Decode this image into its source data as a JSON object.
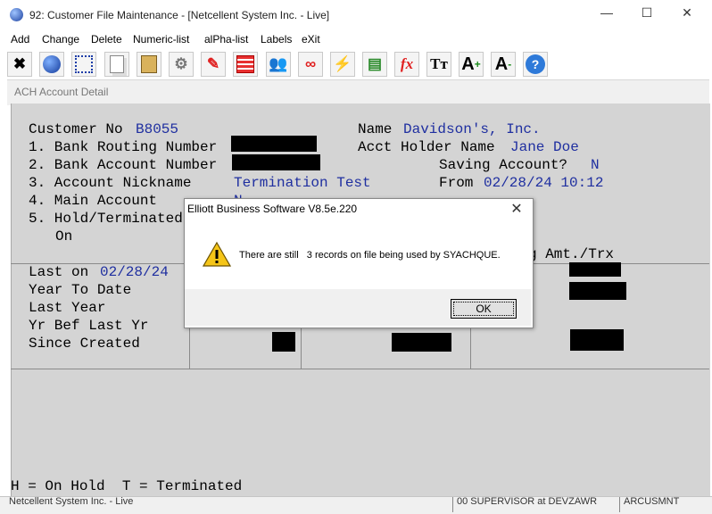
{
  "window": {
    "title": "92: Customer File Maintenance - [Netcellent System Inc. - Live]",
    "minimize": "—",
    "maximize": "☐",
    "close": "✕"
  },
  "menu": {
    "items": [
      "Add",
      "Change",
      "Delete",
      "Numeric-list",
      "alPha-list",
      "Labels",
      "eXit"
    ]
  },
  "toolbar": {
    "icons": [
      "exit-icon",
      "globe-icon",
      "select-icon",
      "copy-icon",
      "paste-icon",
      "settings-icon",
      "edit-icon",
      "table-icon",
      "users-icon",
      "link-icon",
      "lightning-icon",
      "chart-icon",
      "function-icon",
      "font-size-icon",
      "font-increase-icon",
      "font-decrease-icon",
      "help-icon"
    ]
  },
  "subwindow": {
    "title": "ACH Account Detail"
  },
  "form": {
    "customer_label": "Customer No",
    "customer_no": "B8055",
    "name_label": "Name",
    "name_value": "Davidson's, Inc.",
    "routing_label": "1. Bank Routing Number",
    "acct_holder_label": "Acct Holder Name",
    "acct_holder_value": "Jane Doe",
    "account_label": "2. Bank Account Number",
    "saving_label": "Saving Account?",
    "saving_value": "N",
    "nickname_label": "3. Account Nickname",
    "nickname_value": "Termination Test",
    "from_label": "From",
    "from_value": "02/28/24 10:12",
    "main_label": "4. Main Account",
    "main_value": "N",
    "hold_label": "5. Hold/Terminated",
    "on_label": "On",
    "avg_header": "g Amt./Trx"
  },
  "history": {
    "last_on_label": "Last on",
    "last_on_value": "02/28/24",
    "rows": [
      "Year To Date",
      "Last Year",
      "Yr Bef Last Yr",
      "Since Created"
    ]
  },
  "footer_legend": "H = On Hold  T = Terminated",
  "statusbar": {
    "left": "Netcellent System Inc. - Live",
    "middle": "00 SUPERVISOR at DEVZAWR",
    "right": "ARCUSMNT"
  },
  "dialog": {
    "title": "Elliott Business Software V8.5e.220",
    "message": "There are still   3 records on file being used by SYACHQUE.",
    "ok_label": "OK",
    "close": "✕"
  },
  "colors": {
    "field_blue": "#1f2fa0",
    "panel_gray": "#d4d4d4",
    "warning_yellow": "#f5c518"
  }
}
